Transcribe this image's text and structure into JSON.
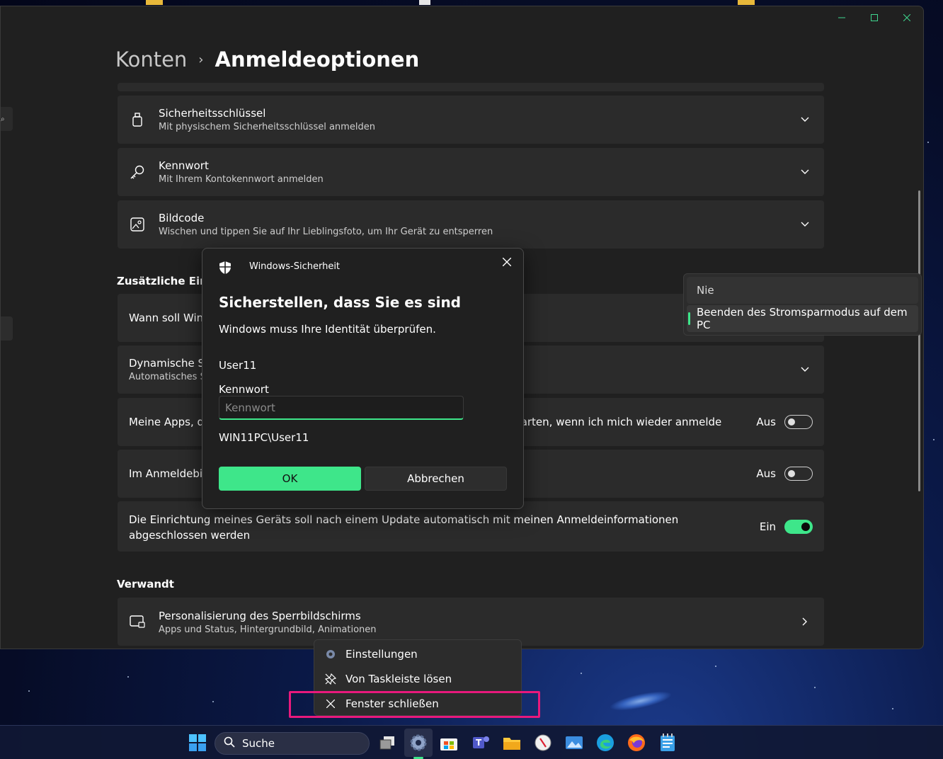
{
  "window": {
    "breadcrumb_parent": "Konten",
    "breadcrumb_current": "Anmeldeoptionen",
    "accent_color": "#3ee68a"
  },
  "signin_options": [
    {
      "title": "Sicherheitsschlüssel",
      "subtitle": "Mit physischem Sicherheitsschlüssel anmelden",
      "icon": "usb-key-icon"
    },
    {
      "title": "Kennwort",
      "subtitle": "Mit Ihrem Kontokennwort anmelden",
      "icon": "key-icon"
    },
    {
      "title": "Bildcode",
      "subtitle": "Wischen und tippen Sie auf Ihr Lieblingsfoto, um Ihr Gerät zu entsperren",
      "icon": "picture-icon"
    }
  ],
  "additional": {
    "heading": "Zusätzliche Einst",
    "when_row": "Wann soll Win",
    "dynamic_title": "Dynamische Sp",
    "dynamic_subtitle": "Automatisches S",
    "apps_row_left": "Meine Apps, d",
    "apps_row_right": "starten, wenn ich mich wieder anmelde",
    "apps_toggle_label": "Aus",
    "lockscreen_row": "Im Anmeldebil",
    "lockscreen_toggle_label": "Aus",
    "update_row": "Die Einrichtung meines Geräts soll nach einem Update automatisch mit meinen Anmeldeinformationen abgeschlossen werden",
    "update_toggle_label": "Ein"
  },
  "related": {
    "heading": "Verwandt",
    "item_title": "Personalisierung des Sperrbildschirms",
    "item_subtitle": "Apps und Status, Hintergrundbild, Animationen"
  },
  "dropdown_popup": {
    "options": [
      "Nie",
      "Beenden des Stromsparmodus auf dem PC"
    ],
    "selected": "Beenden des Stromsparmodus auf dem PC"
  },
  "security_dialog": {
    "app_name": "Windows-Sicherheit",
    "title": "Sicherstellen, dass Sie es sind",
    "description": "Windows muss Ihre Identität überprüfen.",
    "username": "User11",
    "password_label": "Kennwort",
    "password_placeholder": "Kennwort",
    "domain_user": "WIN11PC\\User11",
    "ok_label": "OK",
    "cancel_label": "Abbrechen"
  },
  "context_menu": {
    "items": [
      "Einstellungen",
      "Von Taskleiste lösen",
      "Fenster schließen"
    ]
  },
  "taskbar": {
    "search_label": "Suche",
    "apps": [
      "start-icon",
      "task-view-icon",
      "settings-icon",
      "store-icon",
      "teams-icon",
      "file-explorer-icon",
      "compass-icon",
      "photos-icon",
      "edge-icon",
      "firefox-icon",
      "notepad-icon"
    ]
  }
}
